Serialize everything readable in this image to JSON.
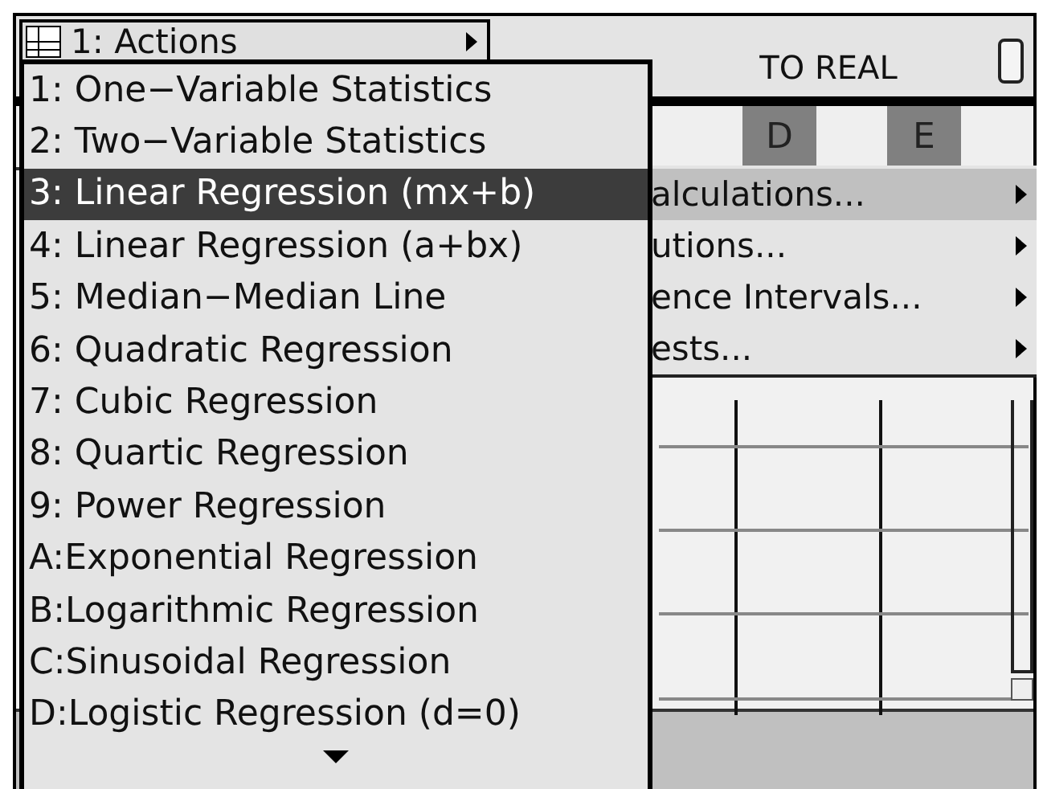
{
  "status_bar": {
    "menu_title": "1: Actions",
    "mode": "TO REAL"
  },
  "columns": [
    {
      "label": "D"
    },
    {
      "label": "E"
    }
  ],
  "submenu": {
    "items": [
      {
        "label": "alculations...",
        "selected": true
      },
      {
        "label": "utions...",
        "selected": false
      },
      {
        "label": "ence Intervals...",
        "selected": false
      },
      {
        "label": "ests...",
        "selected": false
      }
    ]
  },
  "actions_menu": {
    "items": [
      {
        "label": "1: One−Variable Statistics",
        "selected": false
      },
      {
        "label": "2: Two−Variable Statistics",
        "selected": false
      },
      {
        "label": "3: Linear Regression (mx+b)",
        "selected": true
      },
      {
        "label": "4: Linear Regression (a+bx)",
        "selected": false
      },
      {
        "label": "5: Median−Median Line",
        "selected": false
      },
      {
        "label": "6: Quadratic Regression",
        "selected": false
      },
      {
        "label": "7: Cubic Regression",
        "selected": false
      },
      {
        "label": "8: Quartic Regression",
        "selected": false
      },
      {
        "label": "9: Power Regression",
        "selected": false
      },
      {
        "label": "A:Exponential Regression",
        "selected": false
      },
      {
        "label": "B:Logarithmic Regression",
        "selected": false
      },
      {
        "label": "C:Sinusoidal Regression",
        "selected": false
      },
      {
        "label": "D:Logistic Regression (d=0)",
        "selected": false
      }
    ]
  }
}
